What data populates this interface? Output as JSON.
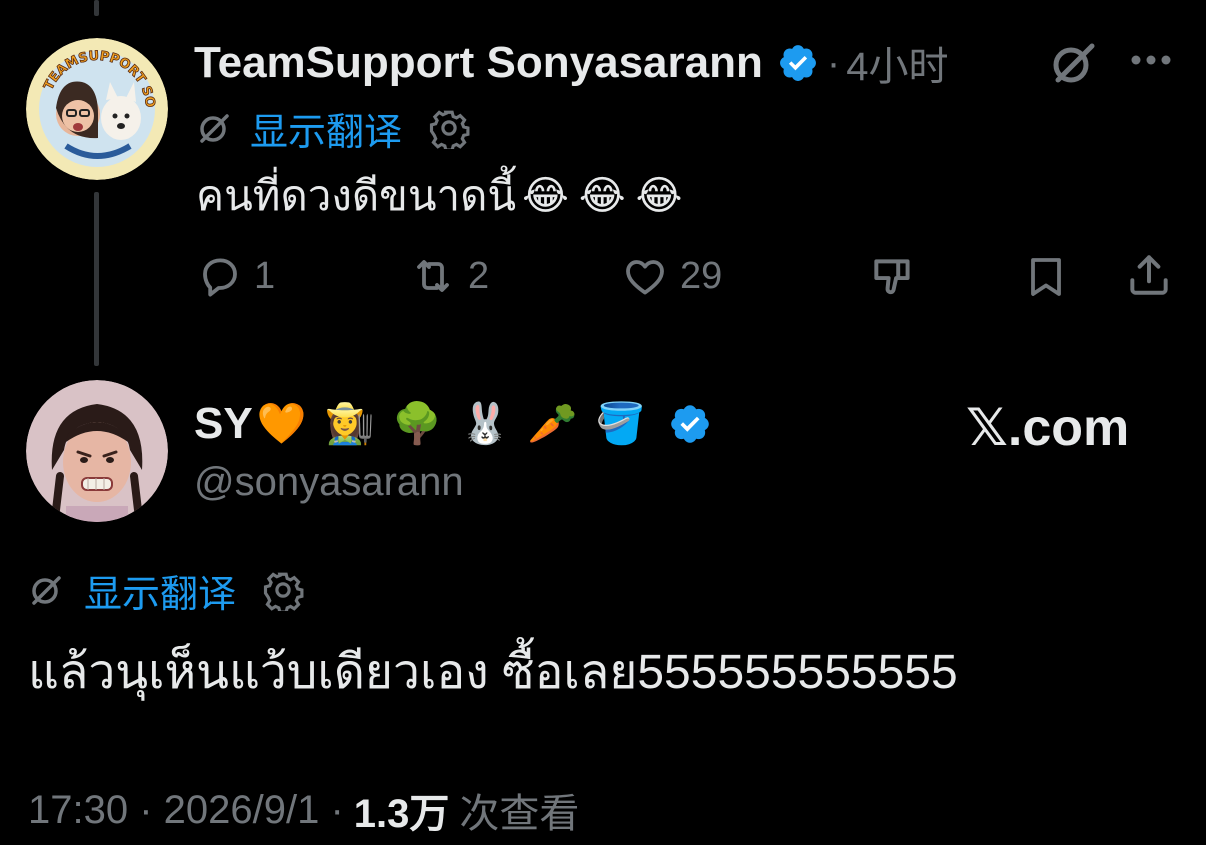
{
  "parent_tweet": {
    "display_name": "TeamSupport Sonyasarann",
    "separator": "·",
    "time": "4小时",
    "avatar_badge_text": "TEAMSUPPORT SONYASARANN",
    "translate_label": "显示翻译",
    "text": "คนที่ดวงดีขนาดนี้",
    "text_emojis": "😂😂😂",
    "replies": "1",
    "reposts": "2",
    "likes": "29",
    "icons": [
      "verified-badge-icon",
      "grok-icon",
      "more-icon",
      "translate-icon",
      "gear-icon",
      "reply-icon",
      "repost-icon",
      "like-icon",
      "dislike-icon",
      "bookmark-icon",
      "share-icon"
    ]
  },
  "main_tweet": {
    "display_name": "SY",
    "name_emojis": "🧡👩‍🌾🌳🐰🥕🪣",
    "handle": "@sonyasarann",
    "watermark": "𝕏.com",
    "translate_label": "显示翻译",
    "text": "แล้วนุเห็นแว้บเดียวเอง ซื้อเลย555555555555",
    "timestamp": "17:30 · 2026/9/1 ·",
    "views_count": "1.3万",
    "views_label": "次查看"
  },
  "colors": {
    "background": "#000000",
    "text": "#e7e9ea",
    "muted": "#71767b",
    "accent": "#1d9bf0"
  }
}
